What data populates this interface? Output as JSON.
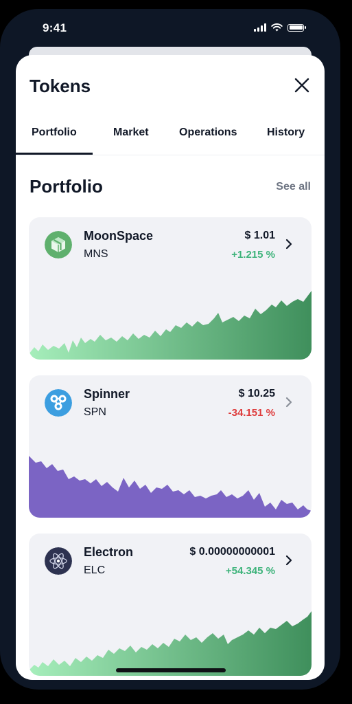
{
  "status_bar": {
    "time": "9:41"
  },
  "sheet": {
    "title": "Tokens"
  },
  "tabs": [
    {
      "label": "Portfolio",
      "active": true
    },
    {
      "label": "Market",
      "active": false
    },
    {
      "label": "Operations",
      "active": false
    },
    {
      "label": "History",
      "active": false
    }
  ],
  "portfolio": {
    "title": "Portfolio",
    "see_all": "See all",
    "tokens": [
      {
        "name": "MoonSpace",
        "ticker": "MNS",
        "price": "$ 1.01",
        "change": "+1.215 %",
        "trend": "up",
        "icon": "moonspace-cube-icon",
        "colors": {
          "change": "#3db37a",
          "chart_from": "#a6eebb",
          "chart_to": "#3f8f5c",
          "icon_bg": "#5fb06d"
        }
      },
      {
        "name": "Spinner",
        "ticker": "SPN",
        "price": "$ 10.25",
        "change": "-34.151 %",
        "trend": "down",
        "icon": "spinner-ripple-icon",
        "colors": {
          "change": "#de3b3b",
          "chart_from": "#7b64c4",
          "chart_to": "#7b64c4",
          "icon_bg": "#3c9ee0"
        }
      },
      {
        "name": "Electron",
        "ticker": "ELC",
        "price": "$ 0.00000000001",
        "change": "+54.345 %",
        "trend": "up",
        "icon": "electron-atom-icon",
        "colors": {
          "change": "#3db37a",
          "chart_from": "#a6eebb",
          "chart_to": "#3f8f5c",
          "icon_bg": "#2d3250"
        }
      }
    ]
  }
}
